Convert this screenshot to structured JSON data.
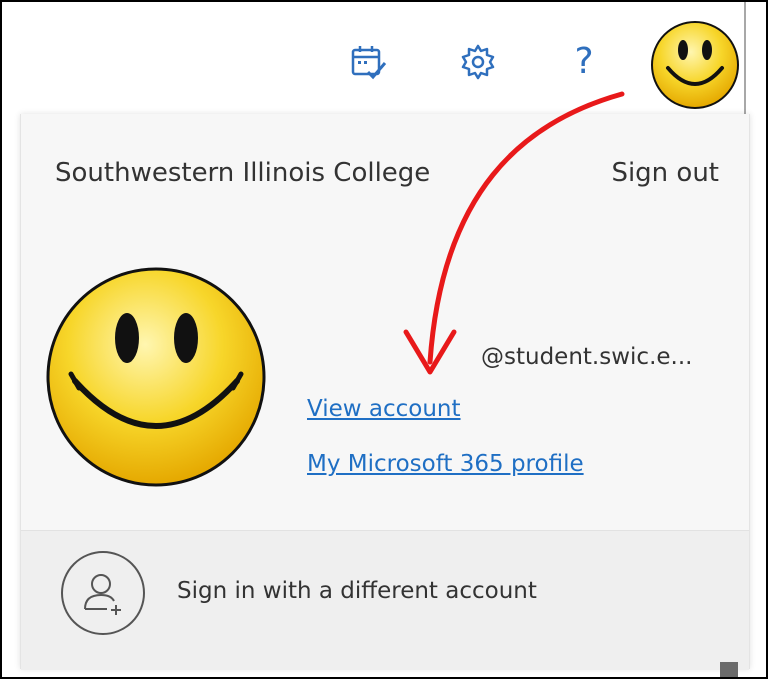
{
  "header": {
    "icons": [
      "calendar-check-icon",
      "gear-icon",
      "help-icon"
    ],
    "help_glyph": "?"
  },
  "account_panel": {
    "organization": "Southwestern Illinois College",
    "sign_out_label": "Sign out",
    "email": "@student.swic.e...",
    "view_account_label": "View account",
    "ms365_profile_label": "My Microsoft 365 profile",
    "switch_account_label": "Sign in with a different account"
  },
  "colors": {
    "link": "#1f6fc4",
    "icon_blue": "#2f6fbd",
    "annotation_arrow": "#e8191a",
    "avatar_yellow": "#f5d21c"
  }
}
